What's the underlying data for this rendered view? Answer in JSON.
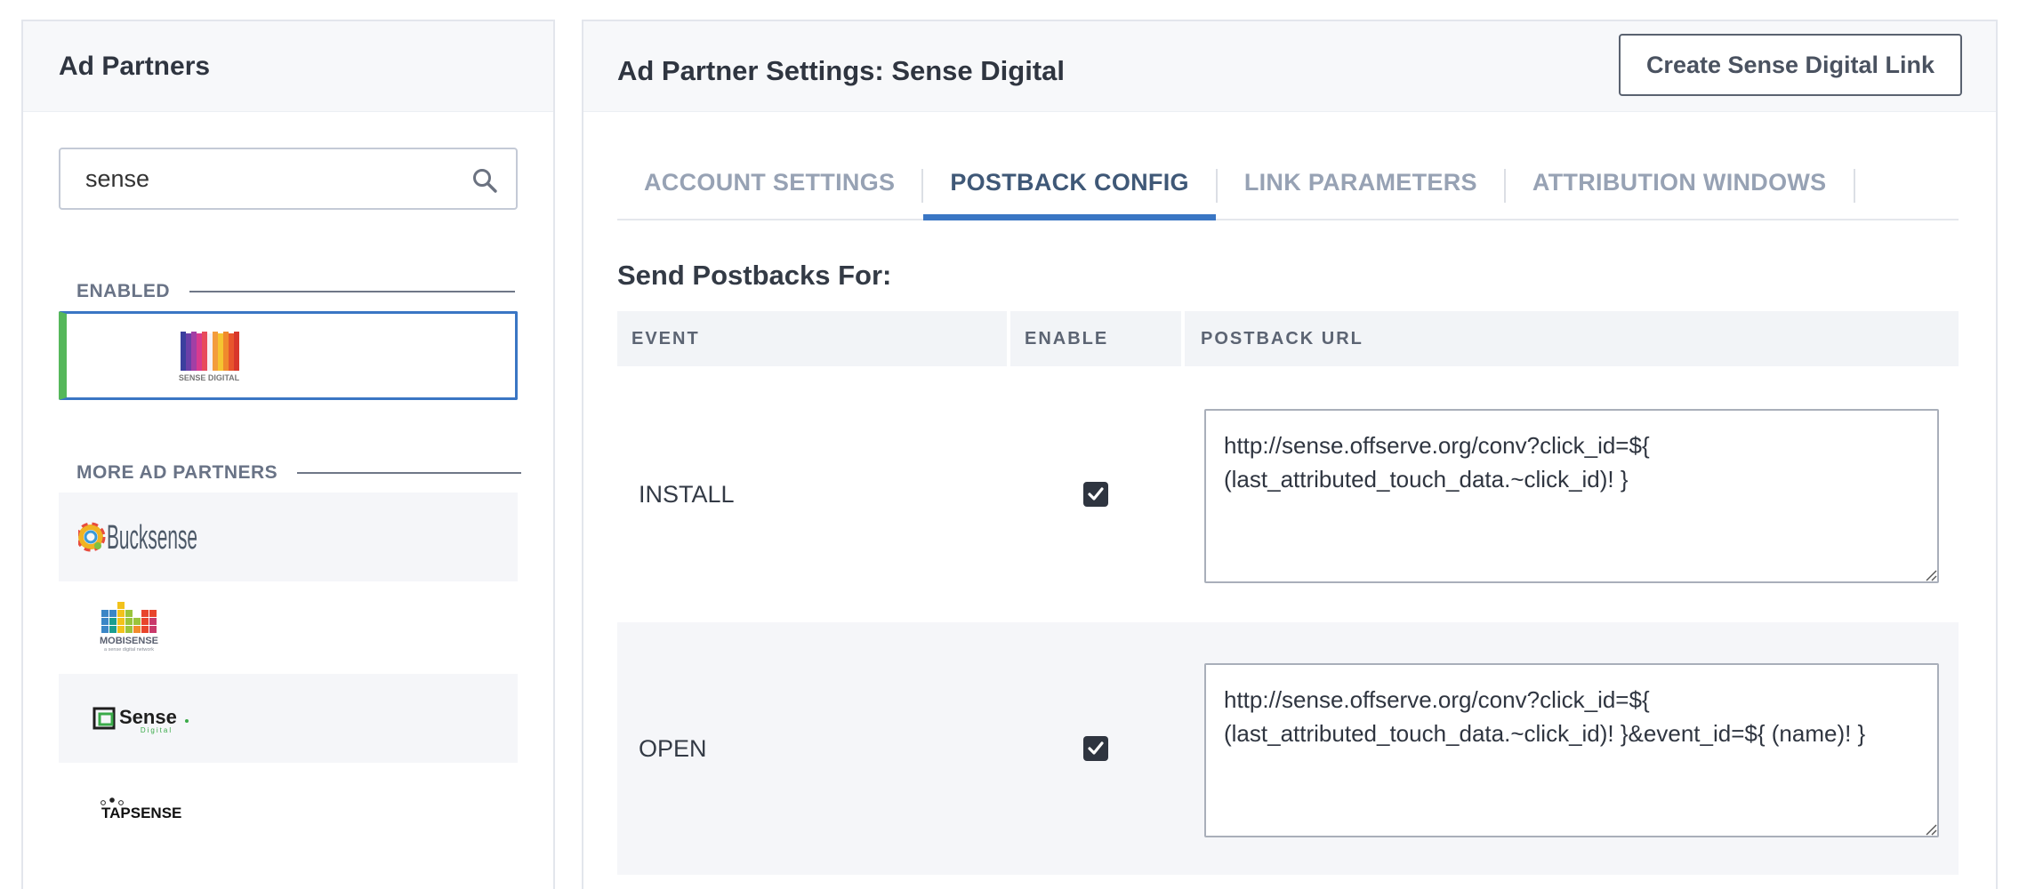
{
  "left_panel": {
    "title": "Ad Partners",
    "search": {
      "value": "sense"
    },
    "enabled_label": "ENABLED",
    "enabled_partners": [
      {
        "name": "Sense Digital",
        "logo_text": "SENSE DIGITAL"
      }
    ],
    "more_label": "MORE AD PARTNERS",
    "more_partners": [
      {
        "name": "Bucksense",
        "logo_text": "Bucksense"
      },
      {
        "name": "Mobisense",
        "logo_text": "MOBISENSE",
        "logo_subtext": "a sense digital network"
      },
      {
        "name": "Sense Digital",
        "logo_text": "Sense",
        "logo_subtext": "Digital"
      },
      {
        "name": "Tapsense",
        "logo_text": "TAPSENSE"
      }
    ]
  },
  "right_panel": {
    "title": "Ad Partner Settings: Sense Digital",
    "create_button": "Create Sense Digital Link",
    "tabs": [
      {
        "label": "ACCOUNT SETTINGS",
        "active": false
      },
      {
        "label": "POSTBACK CONFIG",
        "active": true
      },
      {
        "label": "LINK PARAMETERS",
        "active": false
      },
      {
        "label": "ATTRIBUTION WINDOWS",
        "active": false
      }
    ],
    "section_title": "Send Postbacks For:",
    "table": {
      "columns": [
        "EVENT",
        "ENABLE",
        "POSTBACK URL"
      ],
      "rows": [
        {
          "event": "INSTALL",
          "enabled": true,
          "url": "http://sense.offserve.org/conv?click_id=${ (last_attributed_touch_data.~click_id)! }"
        },
        {
          "event": "OPEN",
          "enabled": true,
          "url": "http://sense.offserve.org/conv?click_id=${ (last_attributed_touch_data.~click_id)! }&event_id=${ (name)! }"
        }
      ]
    }
  },
  "colors": {
    "accent_blue": "#3a76c4",
    "enabled_green": "#55b75a",
    "panel_header_bg": "#f7f8fa",
    "text_dark": "#2f3540"
  },
  "icons": [
    "search-icon",
    "checkmark-icon",
    "resize-grip-icon"
  ]
}
